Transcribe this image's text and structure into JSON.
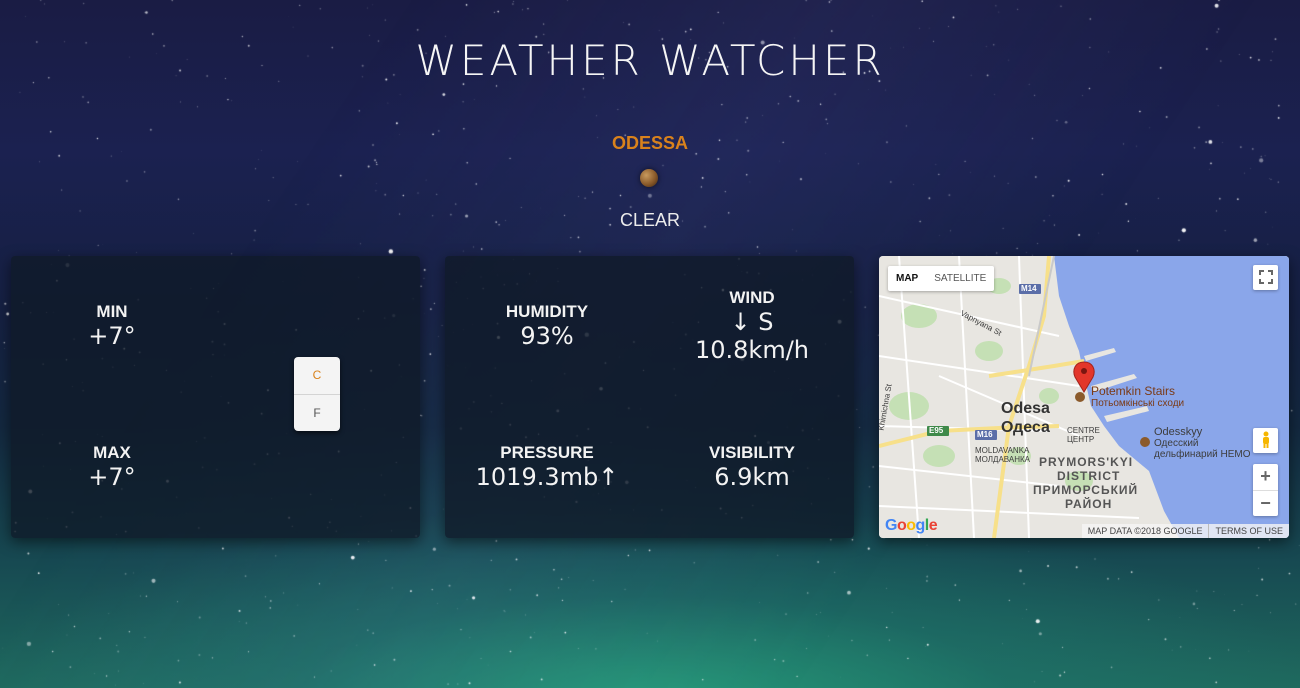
{
  "app": {
    "title": "WEATHER WATCHER"
  },
  "location": {
    "city": "ODESSA",
    "condition": "CLEAR",
    "condition_icon": "moon-icon"
  },
  "temperature": {
    "min_label": "MIN",
    "min_value": "+7°",
    "max_label": "MAX",
    "max_value": "+7°",
    "unit_toggle": {
      "options": [
        "C",
        "F"
      ],
      "selected": "C"
    }
  },
  "stats": {
    "humidity_label": "HUMIDITY",
    "humidity_value": "93%",
    "wind_label": "WIND",
    "wind_direction": "↓ S",
    "wind_speed": "10.8km/h",
    "pressure_label": "PRESSURE",
    "pressure_value": "1019.3mb↑",
    "visibility_label": "VISIBILITY",
    "visibility_value": "6.9km"
  },
  "map": {
    "type_options": [
      "MAP",
      "SATELLITE"
    ],
    "selected_type": "MAP",
    "labels": {
      "marker_name": "Potemkin Stairs",
      "marker_name_local": "Потьомкінські сходи",
      "city_en": "Odesa",
      "city_local": "Одеса",
      "centre": "CENTRE",
      "centre_local": "ЦЕНТР",
      "district_1": "MOLDAVANKA",
      "district_1_local": "МОЛДАВАНКА",
      "district_2": "PRYMORS'KYI",
      "district_2b": "DISTRICT",
      "district_2_local": "ПРИМОРСЬКИЙ",
      "district_2_local_b": "РАЙОН",
      "poi_1": "Odesskyy",
      "poi_1_local": "Одесский",
      "poi_1_local_b": "дельфинарий НЕМО",
      "street_1": "Vapnyana St",
      "street_2": "Khimichna St",
      "road_m14": "M14",
      "road_e95": "E95",
      "road_m16": "M16"
    },
    "zoom_in": "+",
    "zoom_out": "−",
    "attribution": "MAP DATA ©2018 GOOGLE",
    "terms": "TERMS OF USE",
    "logo": "Google",
    "colors": {
      "water": "#8aa6ea",
      "land": "#e8e6e1",
      "park": "#c5e0b5",
      "road_major": "#f7e08a",
      "marker": "#e3362a"
    }
  },
  "colors": {
    "accent": "#d9821c"
  }
}
